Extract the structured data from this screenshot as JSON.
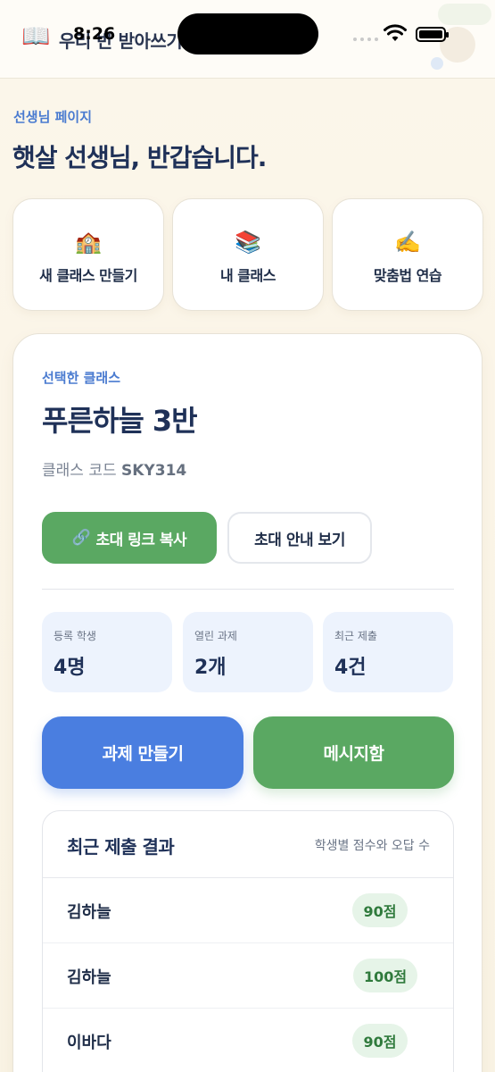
{
  "status_bar": {
    "time": "8:26"
  },
  "app_bar": {
    "icon": "📖",
    "title": "우리 반 받아쓰기"
  },
  "header": {
    "page_label": "선생님 페이지",
    "greeting": "햇살 선생님, 반갑습니다."
  },
  "quick_actions": [
    {
      "icon": "🏫",
      "label": "새 클래스 만들기"
    },
    {
      "icon": "📚",
      "label": "내 클래스"
    },
    {
      "icon": "✍️",
      "label": "맞춤법 연습"
    }
  ],
  "class_card": {
    "selected_label": "선택한 클래스",
    "class_name": "푸른하늘 3반",
    "code_label": "클래스 코드",
    "code_value": "SKY314",
    "copy_link": {
      "icon": "🔗",
      "label": "초대 링크 복사"
    },
    "invite_guide_label": "초대 안내 보기",
    "stats": [
      {
        "label": "등록 학생",
        "value": "4명"
      },
      {
        "label": "열린 과제",
        "value": "2개"
      },
      {
        "label": "최근 제출",
        "value": "4건"
      }
    ],
    "create_assignment_label": "과제 만들기",
    "message_label": "메시지함"
  },
  "recent_results": {
    "title": "최근 제출 결과",
    "subtitle": "학생별 점수와 오답 수",
    "rows": [
      {
        "name": "김하늘",
        "score": "90점"
      },
      {
        "name": "김하늘",
        "score": "100점"
      },
      {
        "name": "이바다",
        "score": "90점"
      }
    ]
  },
  "colors": {
    "accent_blue": "#4a7ee0",
    "accent_green": "#5aa862",
    "score_badge_bg": "#e6f4e8"
  }
}
